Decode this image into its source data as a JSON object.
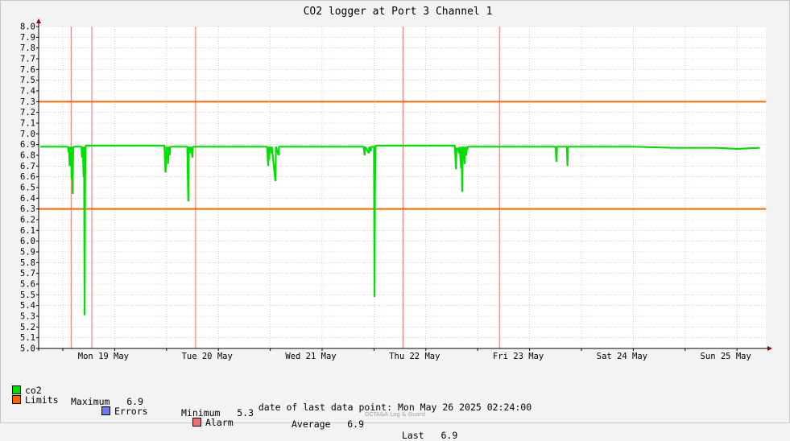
{
  "chart_data": {
    "type": "line",
    "title": "CO2 logger at Port 3 Channel 1",
    "ylim": [
      5.0,
      8.0
    ],
    "y_ticks": [
      "5.0",
      "5.1",
      "5.2",
      "5.3",
      "5.4",
      "5.5",
      "5.6",
      "5.7",
      "5.8",
      "5.9",
      "6.0",
      "6.1",
      "6.2",
      "6.3",
      "6.4",
      "6.5",
      "6.6",
      "6.7",
      "6.8",
      "6.9",
      "7.0",
      "7.1",
      "7.2",
      "7.3",
      "7.4",
      "7.5",
      "7.6",
      "7.7",
      "7.8",
      "7.9",
      "8.0"
    ],
    "x_labels": [
      "Mon 19 May",
      "Tue 20 May",
      "Wed 21 May",
      "Thu 22 May",
      "Fri 23 May",
      "Sat 24 May",
      "Sun 25 May"
    ],
    "grid": true,
    "limits": {
      "upper": 7.3,
      "lower": 6.3
    },
    "alarm_times_days": [
      0.08,
      0.28,
      1.28,
      3.28,
      4.21
    ],
    "series": [
      {
        "name": "co2",
        "color": "#00e000",
        "baseline": 6.88,
        "end_value": 6.87,
        "dips": [
          [
            0.0,
            6.88
          ],
          [
            0.05,
            6.88
          ],
          [
            0.055,
            6.83
          ],
          [
            0.06,
            6.88
          ],
          [
            0.065,
            6.7
          ],
          [
            0.07,
            6.88
          ],
          [
            0.075,
            6.72
          ],
          [
            0.08,
            6.88
          ],
          [
            0.085,
            6.58
          ],
          [
            0.09,
            6.88
          ],
          [
            0.095,
            6.44
          ],
          [
            0.1,
            6.88
          ],
          [
            0.18,
            6.88
          ],
          [
            0.185,
            6.78
          ],
          [
            0.19,
            6.88
          ],
          [
            0.195,
            6.83
          ],
          [
            0.2,
            6.6
          ],
          [
            0.205,
            6.88
          ],
          [
            0.21,
            5.31
          ],
          [
            0.215,
            6.55
          ],
          [
            0.22,
            6.89
          ],
          [
            0.98,
            6.89
          ],
          [
            0.99,
            6.64
          ],
          [
            1.0,
            6.88
          ],
          [
            1.005,
            6.78
          ],
          [
            1.01,
            6.88
          ],
          [
            1.015,
            6.72
          ],
          [
            1.02,
            6.88
          ],
          [
            1.03,
            6.8
          ],
          [
            1.035,
            6.88
          ],
          [
            1.2,
            6.88
          ],
          [
            1.21,
            6.37
          ],
          [
            1.215,
            6.88
          ],
          [
            1.23,
            6.82
          ],
          [
            1.235,
            6.88
          ],
          [
            1.25,
            6.78
          ],
          [
            1.255,
            6.88
          ],
          [
            1.97,
            6.88
          ],
          [
            1.98,
            6.7
          ],
          [
            1.985,
            6.88
          ],
          [
            1.99,
            6.76
          ],
          [
            1.995,
            6.88
          ],
          [
            2.01,
            6.82
          ],
          [
            2.015,
            6.88
          ],
          [
            2.05,
            6.56
          ],
          [
            2.055,
            6.88
          ],
          [
            2.08,
            6.8
          ],
          [
            2.085,
            6.88
          ],
          [
            2.9,
            6.88
          ],
          [
            2.91,
            6.8
          ],
          [
            2.915,
            6.88
          ],
          [
            2.95,
            6.82
          ],
          [
            2.955,
            6.88
          ],
          [
            2.97,
            6.84
          ],
          [
            2.975,
            6.88
          ],
          [
            3.0,
            6.88
          ],
          [
            3.005,
            5.48
          ],
          [
            3.01,
            6.53
          ],
          [
            3.015,
            6.89
          ],
          [
            3.78,
            6.89
          ],
          [
            3.79,
            6.67
          ],
          [
            3.795,
            6.87
          ],
          [
            3.8,
            6.85
          ],
          [
            3.805,
            6.87
          ],
          [
            3.82,
            6.82
          ],
          [
            3.825,
            6.88
          ],
          [
            3.84,
            6.68
          ],
          [
            3.845,
            6.88
          ],
          [
            3.85,
            6.46
          ],
          [
            3.855,
            6.84
          ],
          [
            3.86,
            6.88
          ],
          [
            3.875,
            6.72
          ],
          [
            3.88,
            6.88
          ],
          [
            3.89,
            6.8
          ],
          [
            3.895,
            6.88
          ],
          [
            3.9,
            6.85
          ],
          [
            3.905,
            6.88
          ],
          [
            4.75,
            6.88
          ],
          [
            4.76,
            6.74
          ],
          [
            4.765,
            6.88
          ],
          [
            4.86,
            6.88
          ],
          [
            4.865,
            6.7
          ],
          [
            4.87,
            6.88
          ],
          [
            5.5,
            6.88
          ],
          [
            5.9,
            6.87
          ],
          [
            6.3,
            6.87
          ],
          [
            6.5,
            6.86
          ],
          [
            6.72,
            6.87
          ]
        ]
      }
    ]
  },
  "legend": {
    "co2_label": "co2",
    "co2_color": "#00e000",
    "max_label": "Maximum",
    "max_value": "6.9",
    "min_label": "Minimum",
    "min_value": "5.3",
    "avg_label": "Average",
    "avg_value": "6.9",
    "last_label": "Last",
    "last_value": "6.9",
    "limits_label": "Limits",
    "limits_color": "#ff6600",
    "errors_label": "Errors",
    "errors_color": "#6a79f7",
    "alarm_label": "Alarm",
    "alarm_color": "#f07070"
  },
  "footer": {
    "last_data_label": "date of last data point:",
    "last_data_value": "Mon May 26 2025 02:24:00",
    "credit": "OCTA&A Log & Guard"
  }
}
